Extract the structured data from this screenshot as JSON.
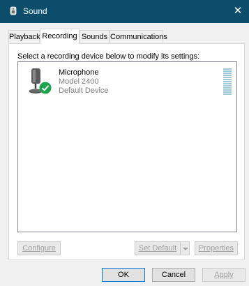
{
  "window": {
    "title": "Sound",
    "close_glyph": "✕"
  },
  "tabs": [
    {
      "label": "Playback"
    },
    {
      "label": "Recording",
      "active": true
    },
    {
      "label": "Sounds"
    },
    {
      "label": "Communications"
    }
  ],
  "instruction": "Select a recording device below to modify its settings:",
  "devices": [
    {
      "name": "Microphone",
      "model": "Model 2400",
      "status": "Default Device",
      "icon": "microphone-icon",
      "badge": "check-badge-icon"
    }
  ],
  "buttons": {
    "configure": {
      "label": "Configure",
      "enabled": false
    },
    "set_default": {
      "label": "Set Default",
      "enabled": false
    },
    "properties": {
      "label": "Properties",
      "enabled": false
    },
    "ok": {
      "label": "OK"
    },
    "cancel": {
      "label": "Cancel"
    },
    "apply": {
      "label": "Apply",
      "enabled": false
    }
  },
  "colors": {
    "titlebar": "#0c4d6c",
    "check_badge": "#1aa34a",
    "meter": "#9ec8d8"
  }
}
